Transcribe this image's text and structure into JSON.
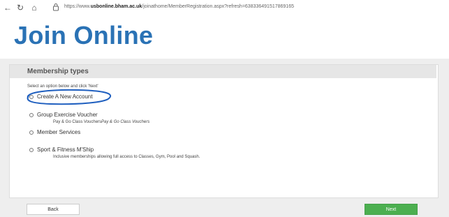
{
  "browser": {
    "url_prefix": "https://www.",
    "url_domain": "usbonline.bham.ac.uk",
    "url_path": "/joinathome/MemberRegistration.aspx?refresh=638336491517869165"
  },
  "page": {
    "heading": "Join Online"
  },
  "membership": {
    "title": "Membership types",
    "instruction": "Select an option below and click 'Next'",
    "options": [
      {
        "label": "Create A New Account",
        "description": "",
        "description_italic": ""
      },
      {
        "label": "Group Exercise Voucher",
        "description": "Pay & Go Class Vouchers",
        "description_italic": "Pay & Go Class Vouchers"
      },
      {
        "label": "Member Services",
        "description": "",
        "description_italic": ""
      },
      {
        "label": "Sport & Fitness M'Ship",
        "description": "Inclusive memberships allowing full access to Classes, Gym, Pool and Squash.",
        "description_italic": ""
      }
    ]
  },
  "footer": {
    "back_label": "Back",
    "next_label": "Next"
  },
  "colors": {
    "heading": "#2a72b5",
    "next_button": "#4caf50",
    "annotation": "#1f5fbf"
  }
}
